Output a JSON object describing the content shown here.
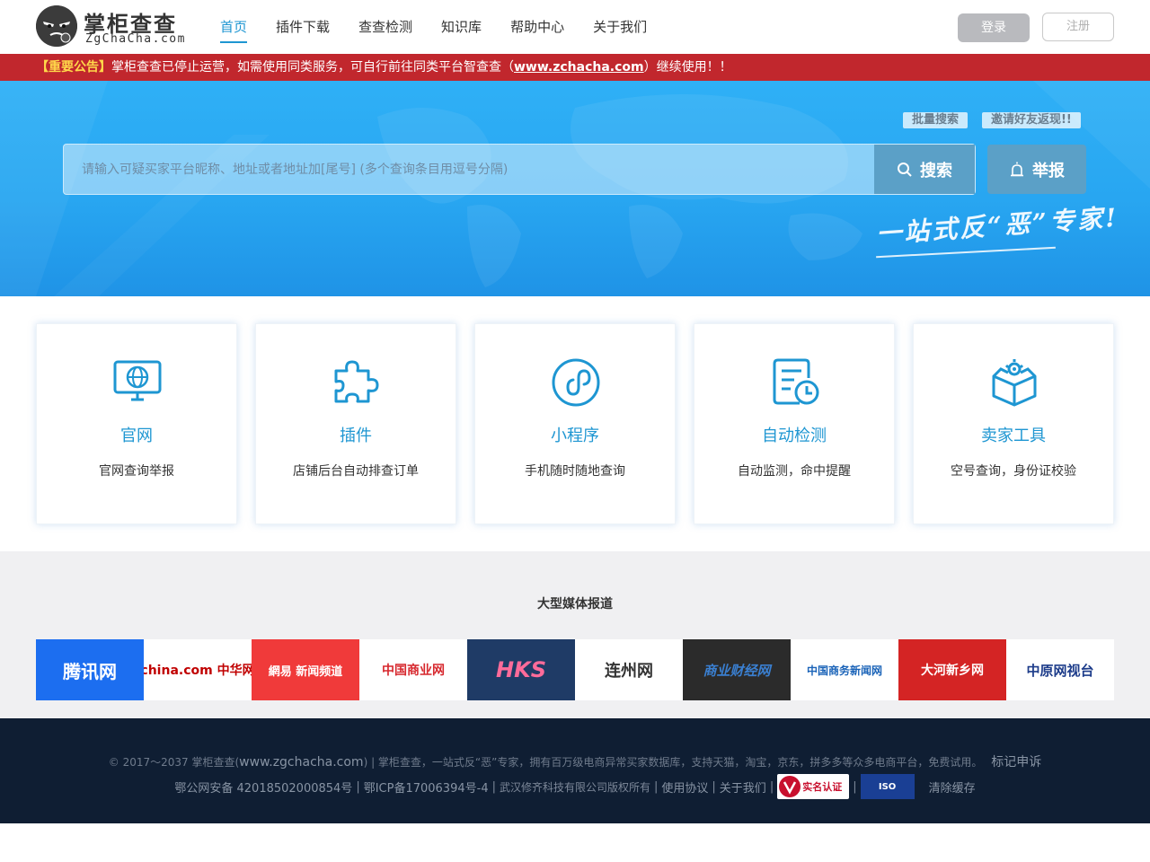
{
  "header": {
    "logo_title": "掌柜查查",
    "logo_sub": "ZgChaCha.com",
    "nav": [
      {
        "label": "首页",
        "active": true
      },
      {
        "label": "插件下载",
        "active": false
      },
      {
        "label": "查查检测",
        "active": false
      },
      {
        "label": "知识库",
        "active": false
      },
      {
        "label": "帮助中心",
        "active": false
      },
      {
        "label": "关于我们",
        "active": false
      }
    ],
    "login_label": "登录",
    "register_label": "注册"
  },
  "notice": {
    "tag": "【重要公告】",
    "text_before": "掌柜查查已停止运营，如需使用同类服务，可自行前往同类平台智查查（",
    "link": "www.zchacha.com",
    "text_after": "）继续使用！！"
  },
  "hero": {
    "batch_search_label": "批量搜索",
    "invite_label": "邀请好友返现!!",
    "search_placeholder": "请输入可疑买家平台昵称、地址或者地址加[尾号] (多个查询条目用逗号分隔)",
    "search_label": "搜索",
    "report_label": "举报",
    "slogan": "一站式反“恶”专家!"
  },
  "cards": [
    {
      "icon": "monitor-globe-icon",
      "title": "官网",
      "desc": "官网查询举报"
    },
    {
      "icon": "puzzle-icon",
      "title": "插件",
      "desc": "店铺后台自动排查订单"
    },
    {
      "icon": "mini-program-icon",
      "title": "小程序",
      "desc": "手机随时随地查询"
    },
    {
      "icon": "document-clock-icon",
      "title": "自动检测",
      "desc": "自动监测，命中提醒"
    },
    {
      "icon": "box-gear-icon",
      "title": "卖家工具",
      "desc": "空号查询，身份证校验"
    }
  ],
  "media": {
    "title": "大型媒体报道",
    "logos": [
      {
        "name": "腾讯网",
        "bg": "#1c6ef0",
        "fg": "#ffffff"
      },
      {
        "name": "china.com 中华网",
        "bg": "#ffffff",
        "fg": "#c00000"
      },
      {
        "name": "網易 新闻频道",
        "bg": "#f03a3a",
        "fg": "#ffffff"
      },
      {
        "name": "中国商业网",
        "bg": "#ffffff",
        "fg": "#d7282e"
      },
      {
        "name": "HKS",
        "bg": "#1f3b66",
        "fg": "#ff6b9a"
      },
      {
        "name": "连州网",
        "bg": "#ffffff",
        "fg": "#333333"
      },
      {
        "name": "商业财经网",
        "bg": "#2b2b2b",
        "fg": "#3a7fd0"
      },
      {
        "name": "中国商务新闻网",
        "bg": "#ffffff",
        "fg": "#1a63b8"
      },
      {
        "name": "大河新乡网",
        "bg": "#d42424",
        "fg": "#ffffff"
      },
      {
        "name": "中原网视台",
        "bg": "#ffffff",
        "fg": "#1d3c8a"
      }
    ]
  },
  "footer": {
    "line1_prefix": "© 2017～2037 掌柜查查(",
    "line1_domain": "www.zgchacha.com",
    "line1_text": ") | 掌柜查查，一站式反“恶”专家，拥有百万级电商异常买家数据库，支持天猫，淘宝，京东，拼多多等众多电商平台，免费试用。",
    "line1_link": "标记申诉",
    "gongan": "鄂公网安备 42018502000854号",
    "icp": "鄂ICP备17006394号-4",
    "company": "武汉修齐科技有限公司版权所有",
    "terms": "使用协议",
    "about": "关于我们",
    "badge_shiming": "实名认证",
    "badge_iso": "ISO",
    "clear_cache": "清除缓存"
  },
  "colors": {
    "brand": "#1e96d2",
    "notice_bg": "#c1272d",
    "footer_bg": "#0f1e33"
  }
}
